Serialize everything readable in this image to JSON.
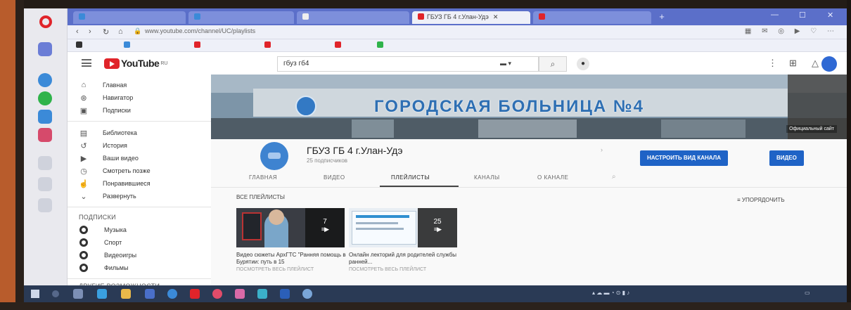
{
  "browser": {
    "active_tab_title": "ГБУЗ ГБ 4 г.Улан-Удэ",
    "url": "www.youtube.com/channel/UC/playlists"
  },
  "youtube": {
    "logo_text": "YouTube",
    "logo_region": "RU",
    "search_value": "гбуз гб4"
  },
  "sidebar": {
    "items": [
      {
        "label": "Главная",
        "icon": "home-icon"
      },
      {
        "label": "Навигатор",
        "icon": "compass-icon"
      },
      {
        "label": "Подписки",
        "icon": "subscriptions-icon"
      }
    ],
    "library_items": [
      {
        "label": "Библиотека",
        "icon": "library-icon"
      },
      {
        "label": "История",
        "icon": "history-icon"
      },
      {
        "label": "Ваши видео",
        "icon": "your-videos-icon"
      },
      {
        "label": "Смотреть позже",
        "icon": "watch-later-icon"
      },
      {
        "label": "Понравившиеся",
        "icon": "like-icon"
      },
      {
        "label": "Развернуть",
        "icon": "chevron-down-icon"
      }
    ],
    "subscriptions_heading": "Подписки",
    "subscriptions": [
      {
        "label": "Музыка"
      },
      {
        "label": "Спорт"
      },
      {
        "label": "Видеоигры"
      },
      {
        "label": "Фильмы"
      }
    ],
    "more_heading": "Другие возможности"
  },
  "banner": {
    "title": "ГОРОДСКАЯ БОЛЬНИЦА №4",
    "badge": "Официальный сайт"
  },
  "channel": {
    "name": "ГБУЗ ГБ 4 г.Улан-Удэ",
    "subscribers": "25 подписчиков",
    "customize_button": "Настроить вид канала",
    "video_button": "Видео"
  },
  "tabs": [
    {
      "label": "Главная",
      "active": false
    },
    {
      "label": "Видео",
      "active": false
    },
    {
      "label": "Плейлисты",
      "active": true
    },
    {
      "label": "Каналы",
      "active": false
    },
    {
      "label": "О канале",
      "active": false
    }
  ],
  "playlists": {
    "heading": "Все плейлисты",
    "sort_label": "Упорядочить",
    "items": [
      {
        "title": "Видео сюжеты АрхГТС \"Ранняя помощь в Бурятии: путь в 15",
        "count": "7",
        "link": "Посмотреть весь плейлист"
      },
      {
        "title": "Онлайн лекторий для родителей службы ранней...",
        "count": "25",
        "link": "Посмотреть весь плейлист"
      }
    ]
  },
  "colors": {
    "brand_red": "#e0242a",
    "accent_blue": "#1f63c6",
    "browser_chrome": "#5b6fc9"
  }
}
